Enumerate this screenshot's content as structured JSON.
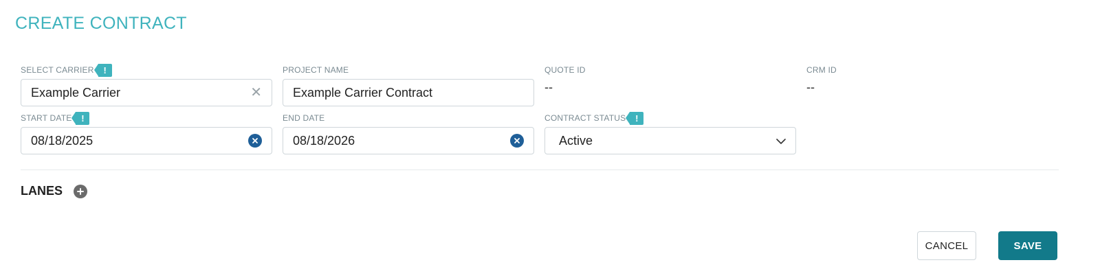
{
  "page": {
    "title": "CREATE CONTRACT"
  },
  "form": {
    "carrier": {
      "label": "SELECT CARRIER",
      "value": "Example Carrier",
      "required_mark": "!"
    },
    "project_name": {
      "label": "PROJECT NAME",
      "value": "Example Carrier Contract"
    },
    "quote_id": {
      "label": "QUOTE ID",
      "value": "--"
    },
    "crm_id": {
      "label": "CRM ID",
      "value": "--"
    },
    "start_date": {
      "label": "START DATE",
      "value": "08/18/2025",
      "required_mark": "!"
    },
    "end_date": {
      "label": "END DATE",
      "value": "08/18/2026"
    },
    "contract_status": {
      "label": "CONTRACT STATUS",
      "value": "Active",
      "required_mark": "!"
    }
  },
  "lanes": {
    "label": "LANES"
  },
  "actions": {
    "cancel_label": "CANCEL",
    "save_label": "SAVE"
  },
  "colors": {
    "title": "#3fb3bd",
    "required_tag": "#3fb3bd",
    "clear_button": "#1f5f98",
    "save_button": "#127a8a",
    "add_button": "#6b6b6b"
  },
  "icons": {
    "clear_text": "close-icon",
    "clear_date": "clear-circle-icon",
    "status_dropdown": "chevron-down-icon",
    "add_lane": "plus-circle-icon"
  }
}
